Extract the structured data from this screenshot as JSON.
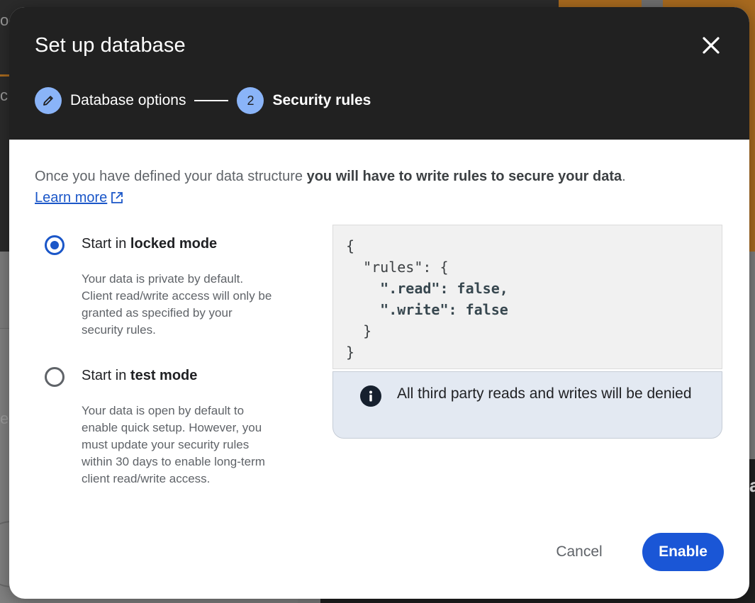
{
  "background": {
    "fragments": [
      "o",
      "c",
      "ea",
      "a"
    ]
  },
  "dialog": {
    "title": "Set up database",
    "close_icon": "close-icon",
    "steps": [
      {
        "label": "Database options",
        "icon": "pencil-icon",
        "status": "completed"
      },
      {
        "number": "2",
        "label": "Security rules",
        "status": "current"
      }
    ],
    "intro": {
      "text_before": "Once you have defined your data structure ",
      "text_bold": "you will have to write rules to secure your data",
      "text_after": ".",
      "learn_more": "Learn more",
      "learn_more_icon": "open-in-new-icon"
    },
    "options": [
      {
        "prefix": "Start in ",
        "mode": "locked mode",
        "selected": true,
        "description": [
          "Your data is private by default.",
          "Client read/write access will only be",
          "granted as specified by your",
          "security rules."
        ]
      },
      {
        "prefix": "Start in ",
        "mode": "test mode",
        "selected": false,
        "description": [
          "Your data is open by default to",
          "enable quick setup. However, you",
          "must update your security rules",
          "within 30 days to enable long-term",
          "client read/write access."
        ]
      }
    ],
    "rules_code": [
      "{",
      "  \"rules\": {",
      "    \".read\": false,",
      "    \".write\": false",
      "  }",
      "}"
    ],
    "info": {
      "icon": "info-icon",
      "text": "All third party reads and writes will be denied"
    },
    "buttons": {
      "cancel": "Cancel",
      "enable": "Enable"
    }
  },
  "colors": {
    "header_bg": "#212121",
    "accent": "#1a56d6",
    "step_circle": "#8ab4f8",
    "info_bg": "#e3e9f2"
  }
}
